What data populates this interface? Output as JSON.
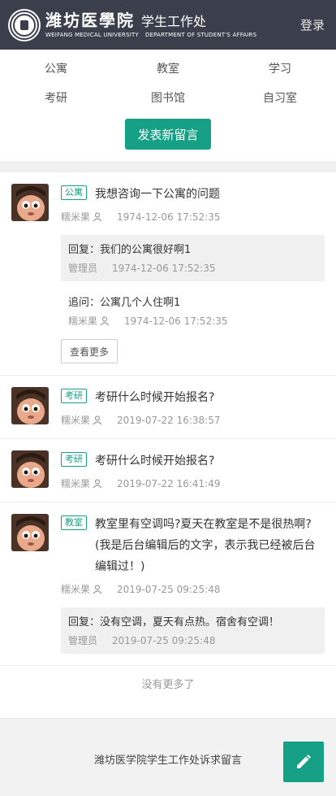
{
  "header": {
    "school_cn": "潍坊医學院",
    "dept_cn": "学生工作处",
    "school_en": "WEIFANG MEDICAL UNIVERSITY",
    "dept_en": "DEPARTMENT OF STUDENT'S AFFAIRS",
    "login": "登录"
  },
  "nav": {
    "items": [
      {
        "label": "公寓"
      },
      {
        "label": "教室"
      },
      {
        "label": "学习"
      },
      {
        "label": "考研"
      },
      {
        "label": "图书馆"
      },
      {
        "label": "自习室"
      }
    ],
    "post_button": "发表新留言"
  },
  "messages": [
    {
      "tag": "公寓",
      "title": "我想咨询一下公寓的问题",
      "user": "糯米果",
      "time": "1974-12-06 17:52:35",
      "reply": {
        "label": "回复：",
        "text": "我们的公寓很好啊1",
        "user": "管理员",
        "time": "1974-12-06 17:52:35"
      },
      "follow": {
        "label": "追问：",
        "text": "公寓几个人住啊1",
        "user": "糯米果",
        "time": "1974-12-06 17:52:35"
      },
      "more_button": "查看更多"
    },
    {
      "tag": "考研",
      "title": "考研什么时候开始报名?",
      "user": "糯米果",
      "time": "2019-07-22 16:38:57"
    },
    {
      "tag": "考研",
      "title": "考研什么时候开始报名?",
      "user": "糯米果",
      "time": "2019-07-22 16:41:49"
    },
    {
      "tag": "教室",
      "title": "教室里有空调吗?夏天在教室是不是很热啊? (我是后台编辑后的文字，表示我已经被后台编辑过！)",
      "user": "糯米果",
      "time": "2019-07-25 09:25:48",
      "reply": {
        "label": "回复：",
        "text": "没有空调，夏天有点热。宿舍有空调！",
        "user": "管理员",
        "time": "2019-07-25 09:25:48"
      }
    }
  ],
  "no_more": "没有更多了",
  "footer": {
    "text": "潍坊医学院学生工作处诉求留言"
  },
  "colors": {
    "accent": "#16a085",
    "header_bg": "#3a3f4b"
  },
  "icons": {
    "user_badge": "user-badge-icon",
    "fab": "pencil-icon",
    "logo": "school-seal-icon"
  }
}
